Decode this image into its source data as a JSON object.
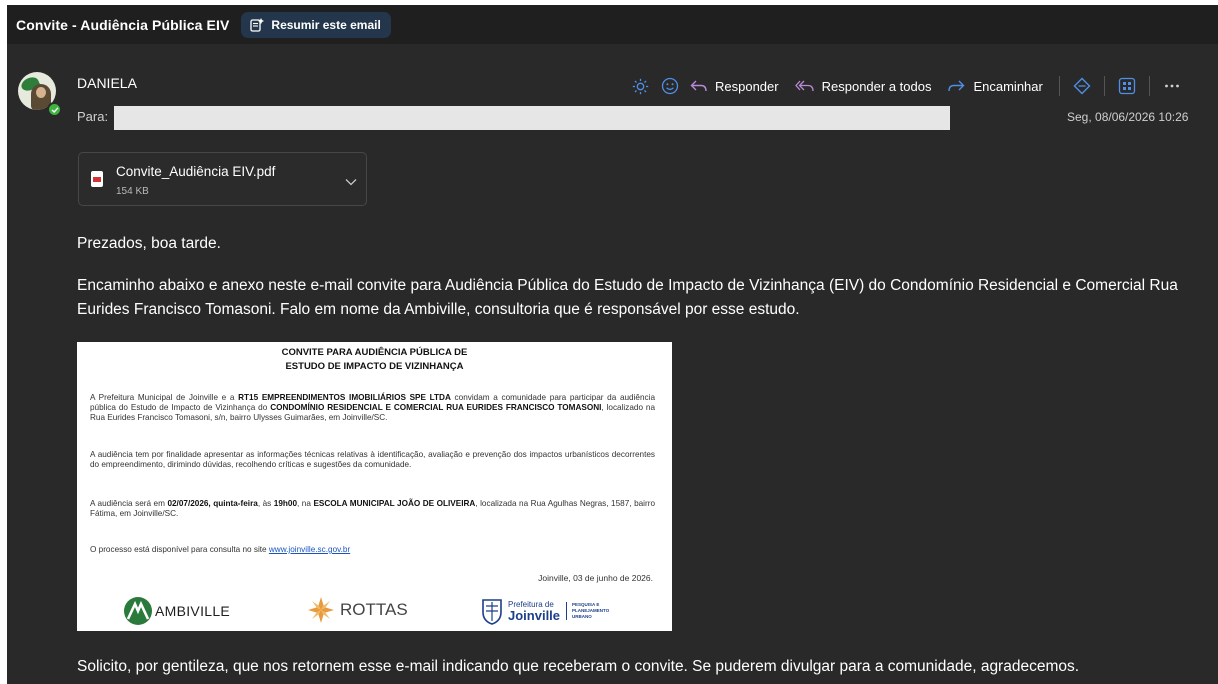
{
  "header": {
    "subject": "Convite - Audiência Pública EIV",
    "summarize_label": "Resumir este email"
  },
  "message": {
    "sender": "DANIELA",
    "to_label": "Para:",
    "datetime": "Seg, 08/06/2026 10:26"
  },
  "actions": {
    "reply_label": "Responder",
    "reply_all_label": "Responder a todos",
    "forward_label": "Encaminhar",
    "icons": [
      "brightness-icon",
      "emoji-icon",
      "reply-icon",
      "reply-all-icon",
      "forward-icon",
      "tag-icon",
      "apps-icon",
      "more-icon"
    ]
  },
  "attachment": {
    "name": "Convite_Audiência EIV.pdf",
    "size": "154 KB"
  },
  "body": {
    "greeting": "Prezados, boa tarde.",
    "paragraph1": "Encaminho abaixo e anexo neste e-mail convite para Audiência Pública do Estudo de Impacto de Vizinhança (EIV) do Condomínio Residencial e Comercial Rua Eurides Francisco Tomasoni. Falo em nome da Ambiville, consultoria que é responsável por esse estudo.",
    "paragraph2": "Solicito, por gentileza, que nos retornem esse e-mail indicando que receberam o convite. Se puderem divulgar para a comunidade, agradecemos."
  },
  "invite": {
    "title1": "CONVITE PARA AUDIÊNCIA PÚBLICA DE",
    "title2": "ESTUDO DE IMPACTO DE VIZINHANÇA",
    "p1_a": "A Prefeitura Municipal de Joinville e a ",
    "p1_b": "RT15 EMPREENDIMENTOS IMOBILIÁRIOS SPE LTDA",
    "p1_c": " convidam a comunidade para participar da audiência pública do Estudo de Impacto de Vizinhança do ",
    "p1_d": "CONDOMÍNIO RESIDENCIAL E COMERCIAL RUA EURIDES FRANCISCO TOMASONI",
    "p1_e": ", localizado na Rua Eurides Francisco Tomasoni, s/n, bairro Ulysses Guimarães, em Joinville/SC.",
    "p2": "A audiência tem por finalidade apresentar as informações técnicas relativas à identificação, avaliação e prevenção dos impactos urbanísticos decorrentes do empreendimento, dirimindo dúvidas, recolhendo críticas e sugestões da comunidade.",
    "p3_a": "A audiência será em ",
    "p3_b": "02/07/2026, quinta-feira",
    "p3_c": ", às ",
    "p3_d": "19h00",
    "p3_e": ", na ",
    "p3_f": "ESCOLA MUNICIPAL JOÃO DE OLIVEIRA",
    "p3_g": ", localizada na Rua Agulhas Negras, 1587, bairro Fátima, em Joinville/SC.",
    "p4": "O processo está disponível para consulta no site ",
    "link": "www.joinville.sc.gov.br",
    "date": "Joinville, 03 de junho de 2026.",
    "logo_ambiville": "AMBIVILLE",
    "logo_rottas": "ROTTAS",
    "logo_prefeitura": "Prefeitura de",
    "logo_joinville": "Joinville",
    "logo_secretaria": "PESQUISA E PLANEJAMENTO URBANO"
  },
  "colors": {
    "background": "#292929",
    "titlebar": "#1f1f1f",
    "accent": "#4f8fe6",
    "summarize_bg": "#24364b",
    "presence": "#3fb33f"
  }
}
